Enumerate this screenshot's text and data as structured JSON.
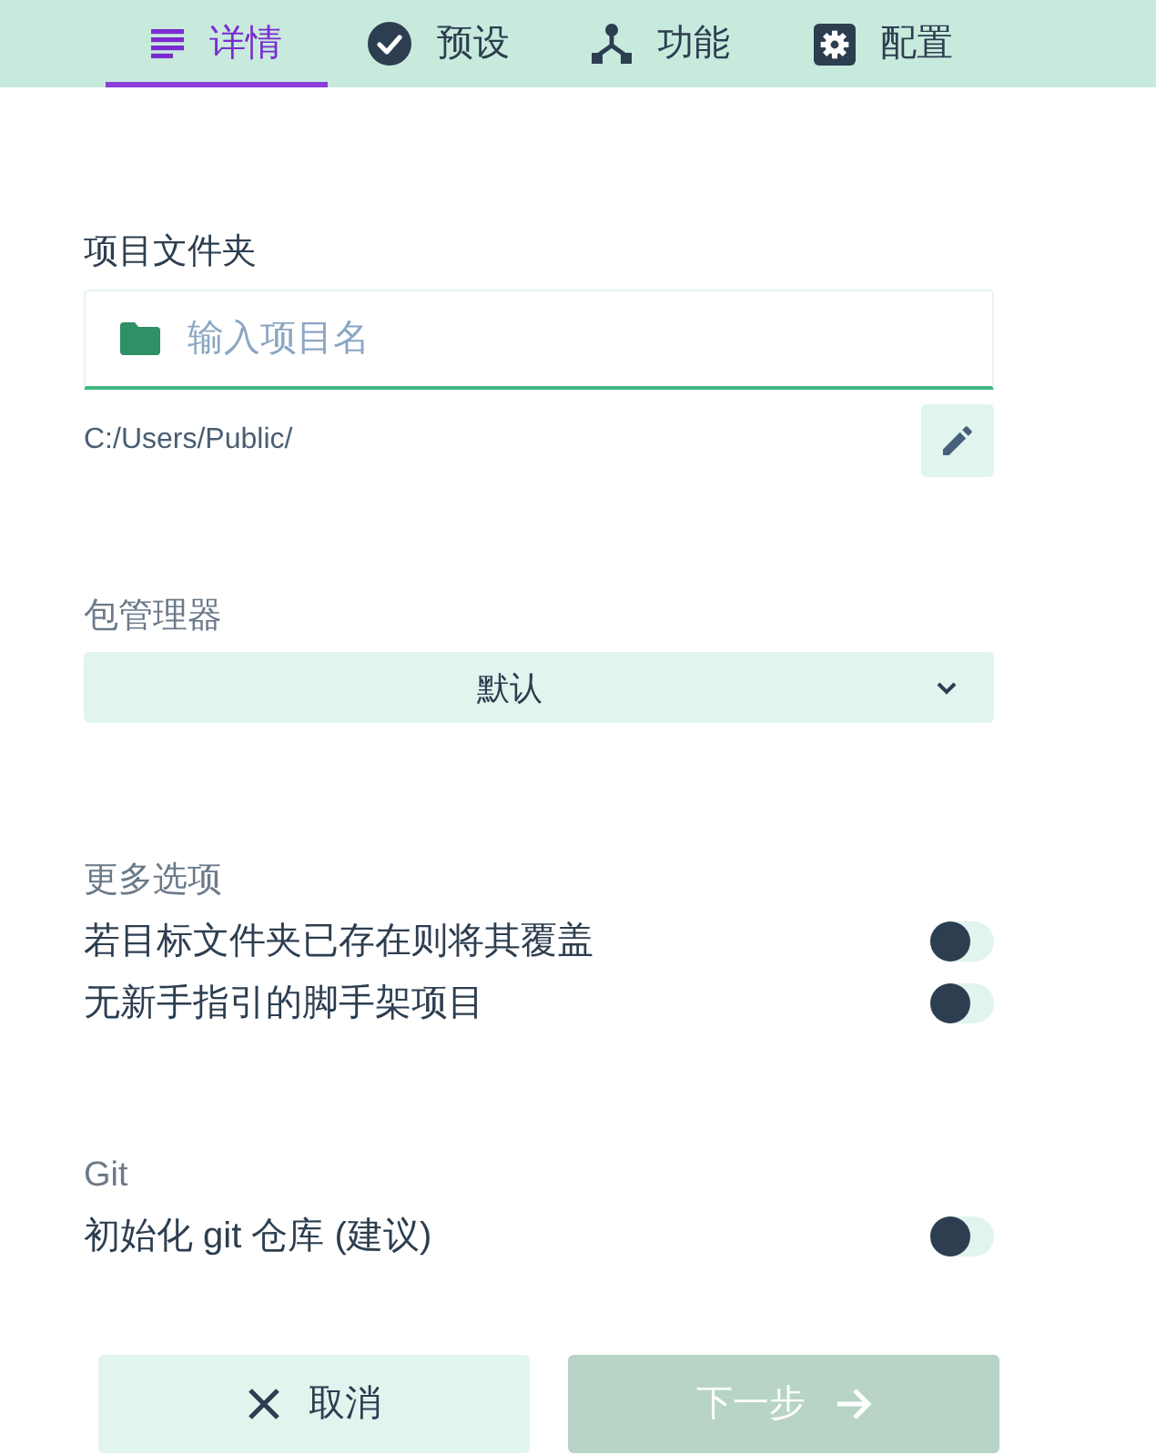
{
  "tabs": [
    {
      "label": "详情",
      "selected": true
    },
    {
      "label": "预设",
      "selected": false
    },
    {
      "label": "功能",
      "selected": false
    },
    {
      "label": "配置",
      "selected": false
    }
  ],
  "project_folder": {
    "label": "项目文件夹",
    "placeholder": "输入项目名",
    "focused": true,
    "path": "C:/Users/Public/"
  },
  "package_manager": {
    "label": "包管理器",
    "value": "默认"
  },
  "more_options": {
    "heading": "更多选项",
    "toggles": [
      {
        "label": "若目标文件夹已存在则将其覆盖",
        "on": false
      },
      {
        "label": "无新手指引的脚手架项目",
        "on": false
      }
    ]
  },
  "git": {
    "heading": "Git",
    "toggles": [
      {
        "label": "初始化 git 仓库 (建议)",
        "on": false
      }
    ]
  },
  "buttons": [
    {
      "label": "取消",
      "kind": "cancel",
      "disabled": false
    },
    {
      "label": "下一步",
      "kind": "next",
      "disabled": true
    }
  ]
}
